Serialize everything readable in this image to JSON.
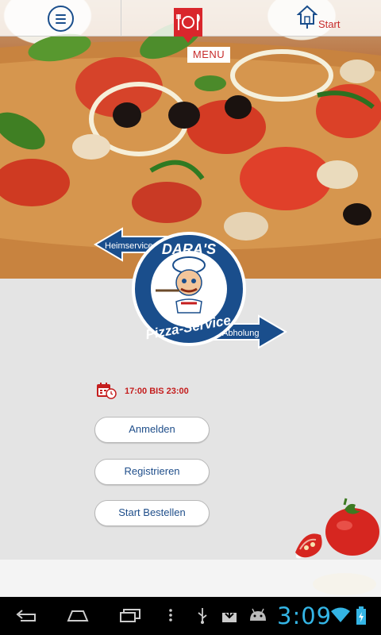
{
  "header": {
    "menu_label": "MENU",
    "start_label": "Start"
  },
  "logo": {
    "arrow_left_text": "Heimservice",
    "arrow_right_text": "Abholung",
    "brand_top": "DARA'S",
    "brand_bottom": "Pizza-Service"
  },
  "hours": {
    "text": "17:00 BIS 23:00"
  },
  "buttons": {
    "login": "Anmelden",
    "register": "Registrieren",
    "start_order": "Start Bestellen"
  },
  "system": {
    "clock": "3:09"
  },
  "colors": {
    "accent_red": "#c72b2b",
    "brand_blue": "#1a4e8c",
    "clock_blue": "#34b5e5",
    "background": "#e4e4e4"
  },
  "icons": {
    "hamburger": "hamburger-menu-icon",
    "restaurant": "restaurant-logo-icon",
    "home": "home-icon",
    "calendar": "calendar-clock-icon"
  }
}
